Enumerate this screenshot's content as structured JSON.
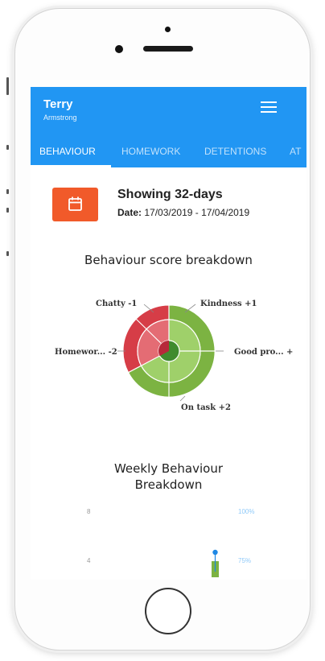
{
  "header": {
    "first_name": "Terry",
    "last_name": "Armstrong"
  },
  "tabs": [
    {
      "label": "BEHAVIOUR",
      "active": true
    },
    {
      "label": "HOMEWORK",
      "active": false
    },
    {
      "label": "DETENTIONS",
      "active": false
    },
    {
      "label": "AT",
      "active": false
    }
  ],
  "period": {
    "title": "Showing 32-days",
    "date_label": "Date:",
    "date_range": "17/03/2019 - 17/04/2019"
  },
  "breakdown": {
    "title": "Behaviour score breakdown",
    "labels": [
      "Chatty -1",
      "Kindness +1",
      "Homewor... -2",
      "Good pro... +",
      "On task +2"
    ]
  },
  "weekly": {
    "title_line1": "Weekly Behaviour",
    "title_line2": "Breakdown",
    "y_ticks": [
      "8",
      "4"
    ],
    "right_ticks": [
      "100%",
      "75%"
    ]
  },
  "colors": {
    "header": "#2196f3",
    "calendar_button": "#f15a2a",
    "positive": "#7cb342",
    "negative": "#d32f2f"
  },
  "icons": [
    "calendar-icon",
    "menu-icon"
  ]
}
